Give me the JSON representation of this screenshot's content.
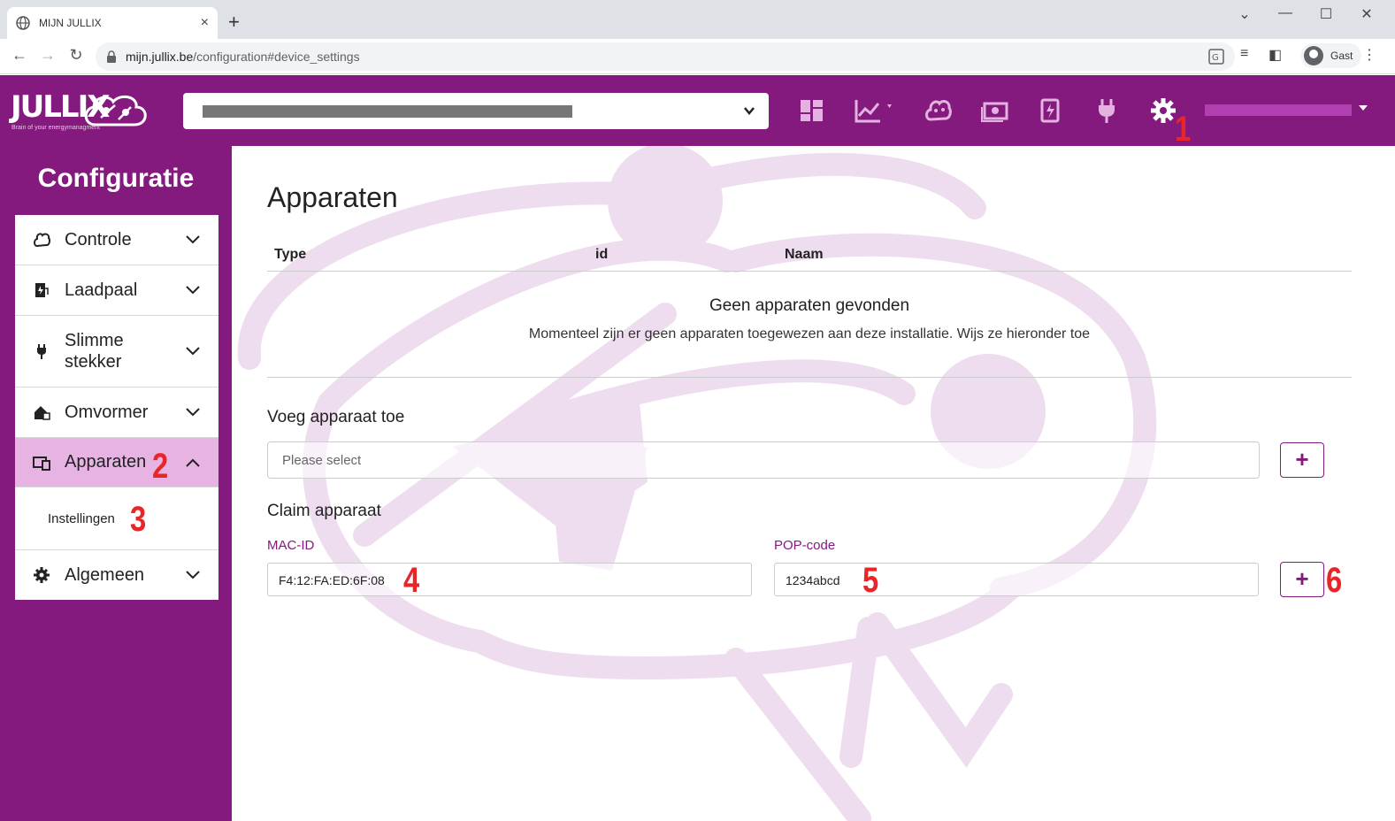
{
  "browser": {
    "tab_title": "MIJN JULLIX",
    "new_tab": "+",
    "close": "×",
    "url_domain": "mijn.jullix.be",
    "url_path": "/configuration#device_settings",
    "profile_name": "Gast"
  },
  "header": {
    "logo_text": "JULLIX",
    "logo_subtitle": "Brain of your energymanagment"
  },
  "sidebar": {
    "title": "Configuratie",
    "items": [
      {
        "label": "Controle",
        "icon": "brain-icon"
      },
      {
        "label": "Laadpaal",
        "icon": "charging-station-icon"
      },
      {
        "label": "Slimme stekker",
        "icon": "plug-icon"
      },
      {
        "label": "Omvormer",
        "icon": "solar-house-icon"
      },
      {
        "label": "Apparaten",
        "icon": "devices-icon"
      },
      {
        "label": "Algemeen",
        "icon": "gear-icon"
      }
    ],
    "submenu_label": "Instellingen"
  },
  "main": {
    "title": "Apparaten",
    "columns": [
      "Type",
      "id",
      "Naam"
    ],
    "empty_title": "Geen apparaten gevonden",
    "empty_message": "Momenteel zijn er geen apparaten toegewezen aan deze installatie. Wijs ze hieronder toe",
    "add_title": "Voeg apparaat toe",
    "add_placeholder": "Please select",
    "claim_title": "Claim apparaat",
    "mac_label": "MAC-ID",
    "mac_value": "F4:12:FA:ED:6F:08",
    "pop_label": "POP-code",
    "pop_value": "1234abcd",
    "plus": "+"
  },
  "annotations": [
    "1",
    "2",
    "3",
    "4",
    "5",
    "6"
  ],
  "colors": {
    "brand": "#84197e",
    "active_item": "#e6b3e3",
    "annotation": "#e8262a"
  }
}
